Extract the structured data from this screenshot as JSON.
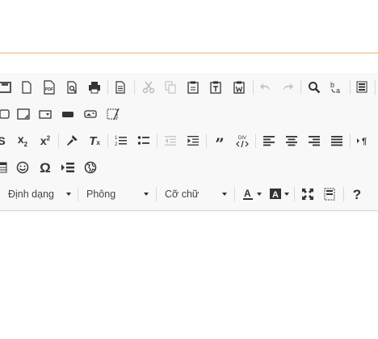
{
  "toolbar": {
    "format_label": "Định dạng",
    "font_label": "Phông",
    "size_label": "Cỡ chữ",
    "help_label": "?",
    "pdf_label": "PDF",
    "div_label": "DIV",
    "superscript_digit": "2",
    "subscript_digit": "2"
  },
  "icons": [
    "save-icon",
    "new-page-icon",
    "export-pdf-icon",
    "preview-icon",
    "print-icon",
    "templates-icon",
    "cut-icon",
    "copy-icon",
    "paste-icon",
    "paste-text-icon",
    "paste-word-icon",
    "undo-icon",
    "redo-icon",
    "find-icon",
    "replace-icon",
    "select-all-icon",
    "checkbox-icon",
    "textarea-icon",
    "select-icon",
    "button-icon",
    "image-button-icon",
    "hidden-field-icon",
    "strikethrough-icon",
    "subscript-icon",
    "superscript-icon",
    "copy-formatting-icon",
    "remove-format-icon",
    "numbered-list-icon",
    "bulleted-list-icon",
    "outdent-icon",
    "indent-icon",
    "blockquote-icon",
    "create-div-icon",
    "align-left-icon",
    "align-center-icon",
    "align-right-icon",
    "justify-icon",
    "text-direction-icon",
    "table-icon",
    "smiley-icon",
    "special-char-icon",
    "page-break-icon",
    "iframe-icon",
    "text-color-icon",
    "bg-color-icon",
    "maximize-icon",
    "show-blocks-icon",
    "help-icon"
  ]
}
